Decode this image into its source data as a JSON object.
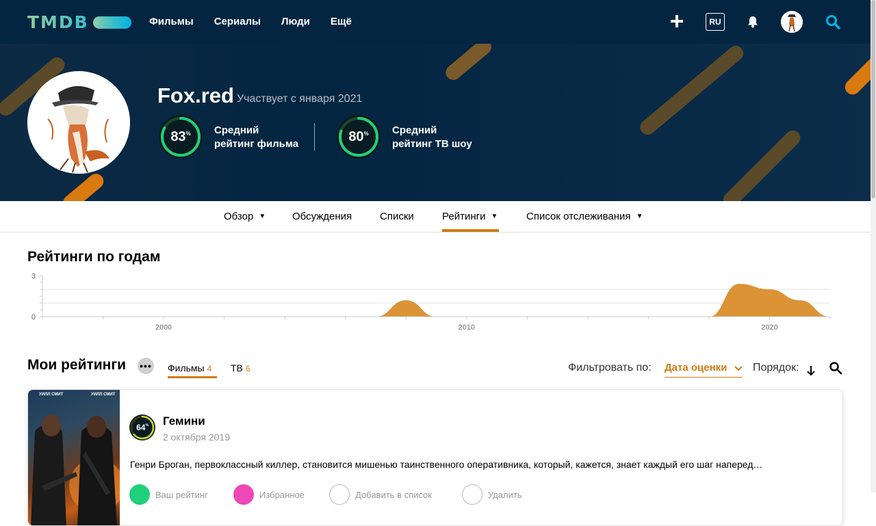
{
  "nav": {
    "logo": "TMDB",
    "menu": [
      "Фильмы",
      "Сериалы",
      "Люди",
      "Ещё"
    ],
    "lang": "RU",
    "icons": [
      "plus-icon",
      "bell-icon",
      "search-icon"
    ]
  },
  "profile": {
    "username": "Fox.red",
    "member_since": "Участвует с января 2021",
    "movie_score": "83",
    "movie_score_fraction": 0.83,
    "movie_label_1": "Средний",
    "movie_label_2": "рейтинг фильма",
    "tv_score": "80",
    "tv_score_fraction": 0.8,
    "tv_label_1": "Средний",
    "tv_label_2": "рейтинг ТВ шоу",
    "percent_sign": "%"
  },
  "subnav": {
    "items": [
      "Обзор",
      "Обсуждения",
      "Списки",
      "Рейтинги",
      "Список отслеживания"
    ],
    "active": "Рейтинги",
    "caret": "▼"
  },
  "chart_title": "Рейтинги по годам",
  "chart_data": {
    "type": "area",
    "title": "Рейтинги по годам",
    "x": [
      1997,
      2007,
      2008,
      2009,
      2017,
      2018,
      2019,
      2020,
      2021,
      2022
    ],
    "values": [
      0,
      0,
      1.2,
      0,
      0,
      0,
      2.4,
      2.0,
      1.2,
      0
    ],
    "xlim": [
      1996,
      2022
    ],
    "ylim": [
      0,
      3
    ],
    "ytick_labels": [
      "3",
      "0"
    ],
    "xtick_labels": [
      "2000",
      "2010",
      "2020"
    ],
    "color": "#dc9335",
    "grid": true
  },
  "ratings": {
    "heading": "Мои рейтинги",
    "more": "•••",
    "tab_movies": "Фильмы",
    "tab_movies_count": "4",
    "tab_tv": "ТВ",
    "tab_tv_count": "6",
    "filter_label": "Фильтровать по:",
    "filter_value": "Дата оценки",
    "order_label": "Порядок:"
  },
  "item": {
    "score": "64",
    "score_fraction": 0.64,
    "title": "Гемини",
    "date": "2 октября 2019",
    "overview": "Генри Броган, первоклассный киллер, становится мишенью таинственного оперативника, который, кажется, знает каждый его шаг наперед…",
    "poster_text_left": "УИЛЛ СМИТ",
    "poster_text_right": "УИЛЛ СМИТ",
    "actions": [
      "Ваш рейтинг",
      "Избранное",
      "Добавить в список",
      "Удалить"
    ]
  },
  "colors": {
    "nav_bg": "#032541",
    "accent": "#d07b10",
    "score_green": "#21d07a",
    "score_yellow": "#d2d531",
    "chart_fill": "#dc9335"
  }
}
